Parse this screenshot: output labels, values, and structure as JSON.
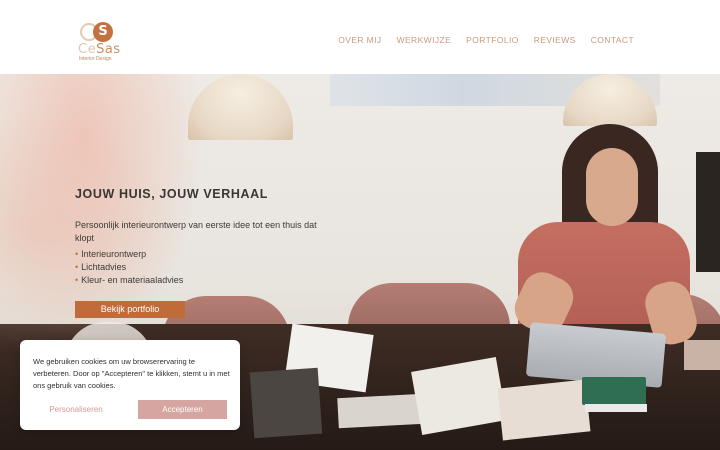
{
  "brand": {
    "logo_letter": "S",
    "name_part1": "Ce",
    "name_part2": "Sas",
    "tagline": "Interior Design"
  },
  "nav": {
    "items": [
      {
        "label": "OVER MIJ"
      },
      {
        "label": "WERKWIJZE"
      },
      {
        "label": "PORTFOLIO"
      },
      {
        "label": "REVIEWS"
      },
      {
        "label": "CONTACT"
      }
    ]
  },
  "hero": {
    "title": "JOUW HUIS, JOUW VERHAAL",
    "subtitle": "Persoonlijk interieurontwerp van eerste idee tot een thuis dat klopt",
    "services": [
      "Interieurontwerp",
      "Lichtadvies",
      "Kleur- en materiaaladvies"
    ],
    "cta_label": "Bekijk portfolio"
  },
  "cookie_banner": {
    "text": "We gebruiken cookies om uw browserervaring te verbeteren. Door op \"Accepteren\" te klikken, stemt u in met ons gebruik van cookies.",
    "personalize_label": "Personaliseren",
    "accept_label": "Accepteren"
  },
  "colors": {
    "accent": "#c06b3a",
    "nav_text": "#c99a7c",
    "cookie_accept_bg": "#d5a5a2"
  }
}
